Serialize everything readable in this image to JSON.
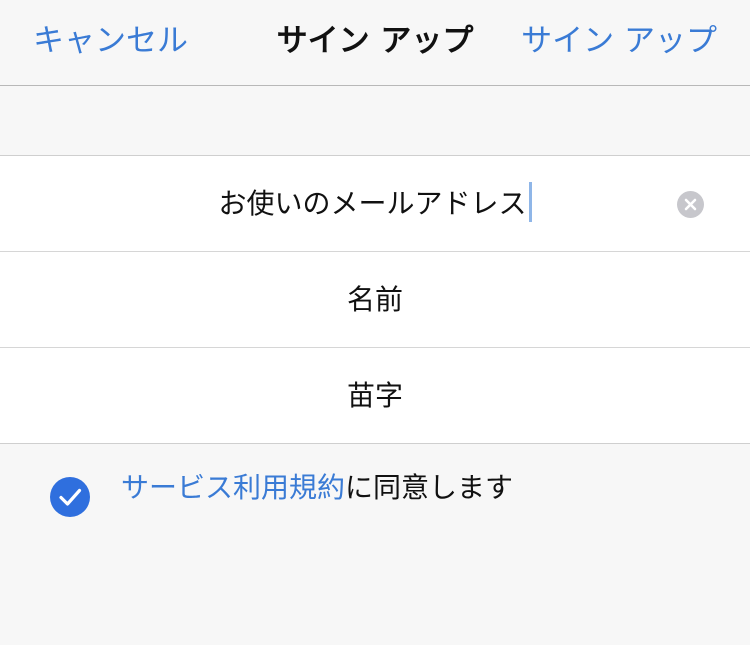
{
  "navbar": {
    "cancel_label": "キャンセル",
    "title": "サイン アップ",
    "signup_label": "サイン アップ"
  },
  "form": {
    "email_placeholder": "お使いのメールアドレス",
    "first_name_placeholder": "名前",
    "last_name_placeholder": "苗字"
  },
  "agreement": {
    "checked": true,
    "terms_link_label": "サービス利用規約",
    "suffix": "に同意します"
  },
  "colors": {
    "accent": "#3a7bd5",
    "checkbox": "#2f6fde",
    "background": "#f7f7f7",
    "clear_button": "#c7c7cc"
  }
}
